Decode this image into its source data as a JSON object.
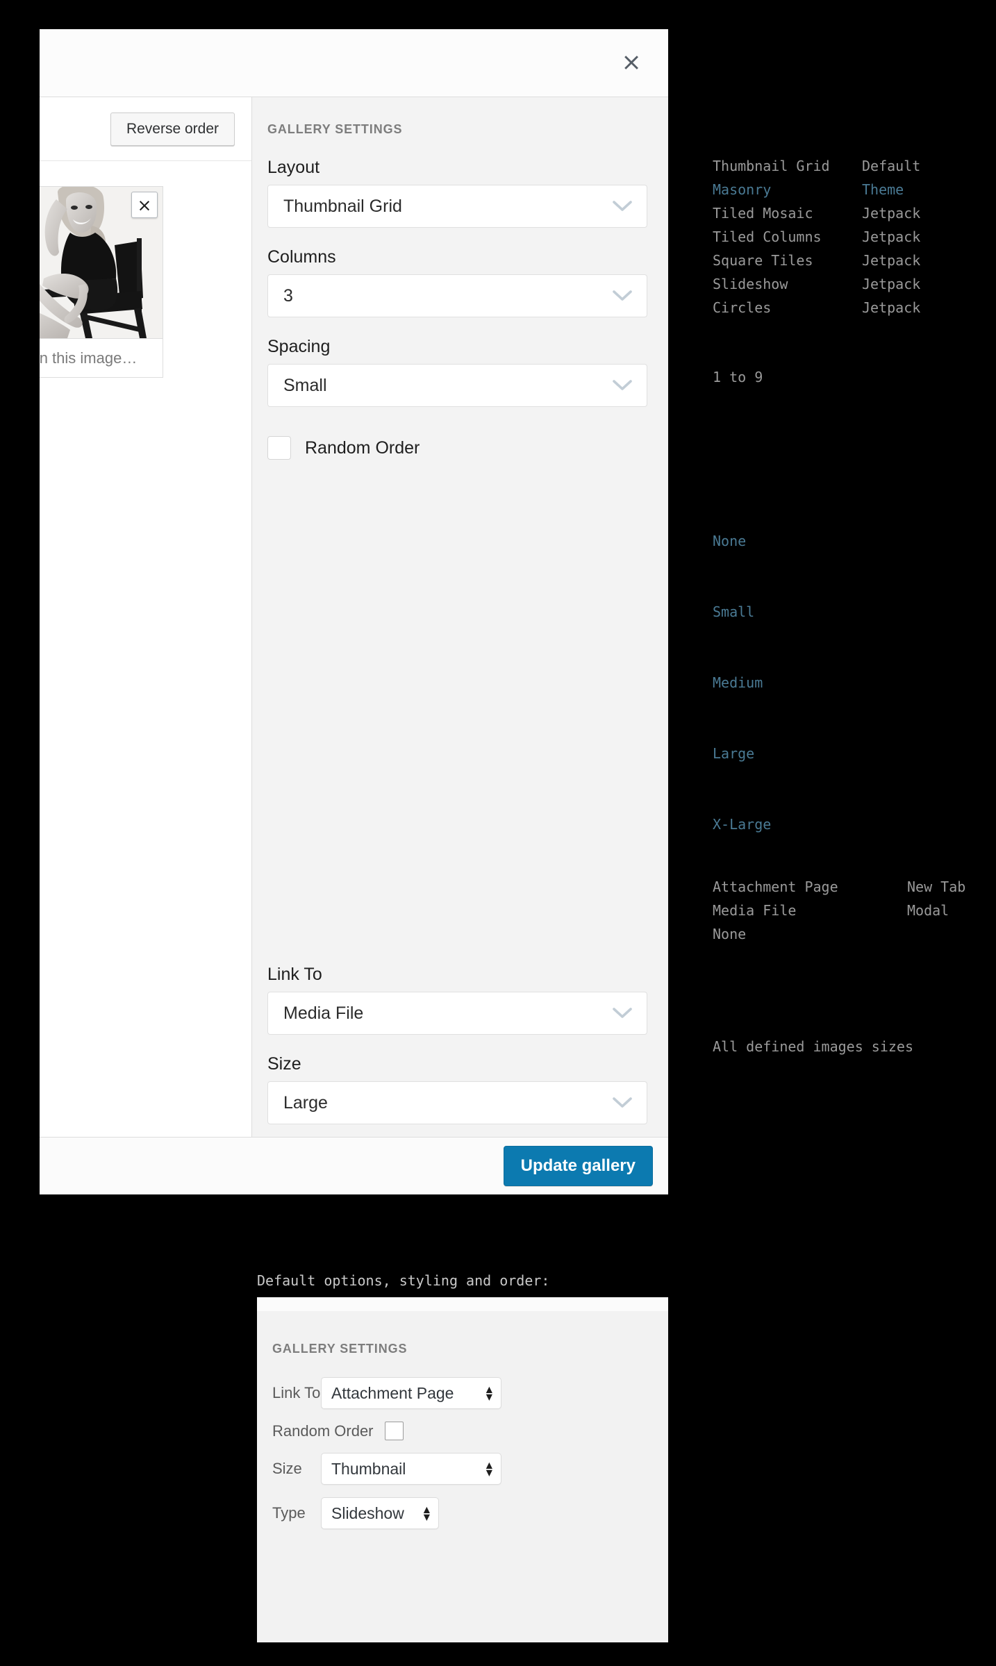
{
  "modal": {
    "close_icon_label": "×",
    "attachments": {
      "reverse_order_label": "Reverse order",
      "remove_icon_label": "×",
      "caption_placeholder": "aption this image…"
    },
    "settings": {
      "section_title": "GALLERY SETTINGS",
      "fields": [
        {
          "label": "Layout",
          "value": "Thumbnail Grid"
        },
        {
          "label": "Columns",
          "value": "3"
        },
        {
          "label": "Spacing",
          "value": "Small"
        }
      ],
      "random_order_label": "Random Order",
      "link_to": {
        "label": "Link To",
        "value": "Media File"
      },
      "size": {
        "label": "Size",
        "value": "Large"
      }
    },
    "footer": {
      "update_label": "Update gallery"
    }
  },
  "annotations": {
    "layout_options": [
      {
        "name": "Thumbnail Grid",
        "source": "Default",
        "highlight": false
      },
      {
        "name": "Masonry",
        "source": "Theme",
        "highlight": true
      },
      {
        "name": "Tiled Mosaic",
        "source": "Jetpack",
        "highlight": false
      },
      {
        "name": "Tiled Columns",
        "source": "Jetpack",
        "highlight": false
      },
      {
        "name": "Square Tiles",
        "source": "Jetpack",
        "highlight": false
      },
      {
        "name": "Slideshow",
        "source": "Jetpack",
        "highlight": false
      },
      {
        "name": "Circles",
        "source": "Jetpack",
        "highlight": false
      }
    ],
    "columns_range": "1 to 9",
    "spacing_options": [
      "None",
      "Small",
      "Medium",
      "Large",
      "X-Large"
    ],
    "link_to_options": [
      {
        "name": "Attachment Page",
        "target": "New Tab"
      },
      {
        "name": "Media File",
        "target": "Modal"
      },
      {
        "name": "None",
        "target": ""
      }
    ],
    "size_note": "All defined images sizes"
  },
  "defaults": {
    "caption": "Default options, styling and order:",
    "section_title": "GALLERY SETTINGS",
    "rows": [
      {
        "label": "Link To",
        "value": "Attachment Page",
        "kind": "select",
        "width": "wide"
      },
      {
        "label": "Random Order",
        "value": "",
        "kind": "checkbox",
        "width": ""
      },
      {
        "label": "Size",
        "value": "Thumbnail",
        "kind": "select",
        "width": "wide"
      },
      {
        "label": "Type",
        "value": "Slideshow",
        "kind": "select",
        "width": "mid"
      }
    ]
  },
  "colors": {
    "accent": "#0c7ab0",
    "annotation_highlight": "#4a7a94",
    "annotation_default": "#9a9a9a",
    "panel_bg": "#f3f3f3"
  }
}
